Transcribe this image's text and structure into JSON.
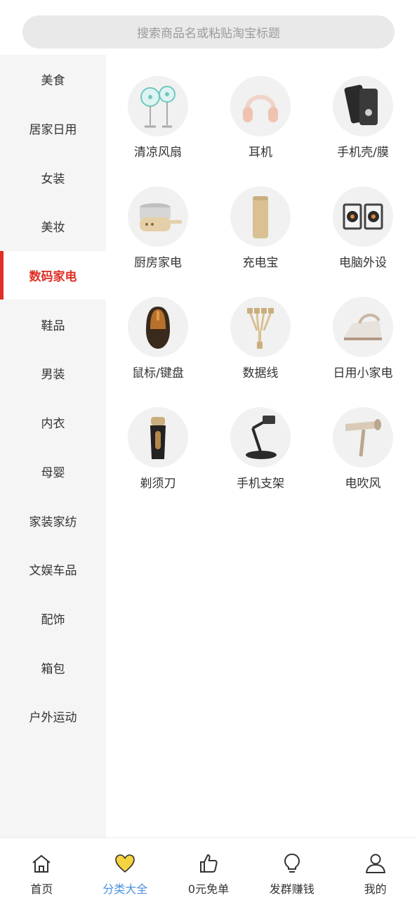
{
  "search": {
    "placeholder": "搜索商品名或粘贴淘宝标题"
  },
  "sidebar": {
    "items": [
      {
        "label": "美食"
      },
      {
        "label": "居家日用"
      },
      {
        "label": "女装"
      },
      {
        "label": "美妆"
      },
      {
        "label": "数码家电",
        "active": true
      },
      {
        "label": "鞋品"
      },
      {
        "label": "男装"
      },
      {
        "label": "内衣"
      },
      {
        "label": "母婴"
      },
      {
        "label": "家装家纺"
      },
      {
        "label": "文娱车品"
      },
      {
        "label": "配饰"
      },
      {
        "label": "箱包"
      },
      {
        "label": "户外运动"
      }
    ]
  },
  "categories": [
    {
      "label": "清凉风扇",
      "icon": "fan-icon"
    },
    {
      "label": "耳机",
      "icon": "headphones-icon"
    },
    {
      "label": "手机壳/膜",
      "icon": "phone-case-icon"
    },
    {
      "label": "厨房家电",
      "icon": "cooker-icon"
    },
    {
      "label": "充电宝",
      "icon": "power-bank-icon"
    },
    {
      "label": "电脑外设",
      "icon": "speakers-icon"
    },
    {
      "label": "鼠标/键盘",
      "icon": "mouse-icon"
    },
    {
      "label": "数据线",
      "icon": "cable-icon"
    },
    {
      "label": "日用小家电",
      "icon": "iron-icon"
    },
    {
      "label": "剃须刀",
      "icon": "shaver-icon"
    },
    {
      "label": "手机支架",
      "icon": "phone-stand-icon"
    },
    {
      "label": "电吹风",
      "icon": "hair-dryer-icon"
    }
  ],
  "bottom_nav": {
    "items": [
      {
        "label": "首页",
        "icon": "home-icon"
      },
      {
        "label": "分类大全",
        "icon": "heart-icon",
        "active": true
      },
      {
        "label": "0元免单",
        "icon": "thumbs-up-icon"
      },
      {
        "label": "发群赚钱",
        "icon": "lightbulb-icon"
      },
      {
        "label": "我的",
        "icon": "user-icon"
      }
    ]
  },
  "colors": {
    "accent": "#e02e24",
    "nav_active": "#4a90e2",
    "heart_fill": "#f5d33f"
  }
}
